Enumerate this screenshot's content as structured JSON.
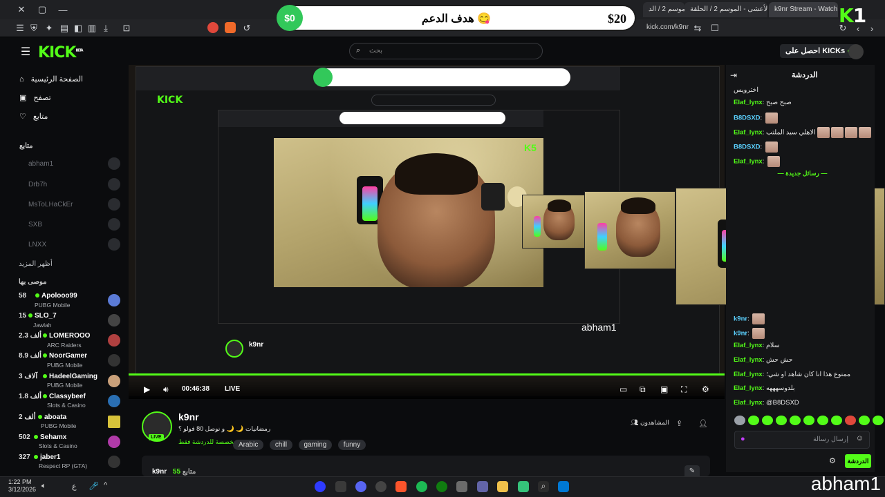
{
  "browser": {
    "tabs": [
      {
        "label": "الموسم 2 / الد"
      },
      {
        "label": "شاهد شارع الأعشى - الموسم 2 / الحلقة"
      },
      {
        "label": "k9nr Stream - Watch Live on Kick"
      }
    ],
    "url": "kick.com/k9nr"
  },
  "goal": {
    "start": "$0",
    "title": "هدف الدعم",
    "amount": "$20"
  },
  "logo_num": "1",
  "header": {
    "brand": "KICK",
    "beta": "BETA",
    "search_placeholder": "بحث",
    "get_kicks": "احصل على KICKs"
  },
  "sidebar": {
    "nav": [
      {
        "label": "الصفحة الرئيسية",
        "icon": "home-icon"
      },
      {
        "label": "تصفح",
        "icon": "browse-icon"
      },
      {
        "label": "متابع",
        "icon": "heart-icon"
      }
    ],
    "following_title": "متابع",
    "following": [
      {
        "name": "abham1"
      },
      {
        "name": "Drb7h"
      },
      {
        "name": "MsToLHaCkEr"
      },
      {
        "name": "SXB"
      },
      {
        "name": "LNXX"
      }
    ],
    "show_more": "أظهر المزيد",
    "recommended_title": "موصى بها",
    "recommended": [
      {
        "count": "58",
        "name": "Apolooo99",
        "category": "PUBG Mobile",
        "color": "#5b7bd6"
      },
      {
        "count": "15",
        "name": "SLO_7",
        "category": "Jawlah",
        "color": "#444"
      },
      {
        "count": "2.3 ألف",
        "name": "LOMEROOO",
        "category": "ARC Raiders",
        "color": "#b04040"
      },
      {
        "count": "8.9 ألف",
        "name": "NoorGamer",
        "category": "PUBG Mobile",
        "color": "#333"
      },
      {
        "count": "3 آلاف",
        "name": "HadeelGaming",
        "category": "PUBG Mobile",
        "color": "#c9a07a"
      },
      {
        "count": "1.8 ألف",
        "name": "Classybeef",
        "category": "Slots & Casino",
        "color": "#2a6fb3"
      },
      {
        "count": "2 ألف",
        "name": "aboata",
        "category": "PUBG Mobile",
        "color": "#d7c23a"
      },
      {
        "count": "502",
        "name": "Sehamx",
        "category": "Slots & Casino",
        "color": "#b03aa8"
      },
      {
        "count": "327",
        "name": "jaber1",
        "category": "Respect RP (GTA)",
        "color": "#333"
      }
    ]
  },
  "player": {
    "time": "00:46:38",
    "live": "LIVE",
    "overlay_name": "abham1"
  },
  "stream": {
    "name": "k9nr",
    "live": "LIVE",
    "title": "رمضانيات 🌙 🌙 و نوصل 80 فولو ؟",
    "subtitle": "مخصصة للدردشة فقط",
    "tags": [
      "Arabic",
      "chill",
      "gaming",
      "funny"
    ],
    "viewers_label": "المشاهدون",
    "followers": "55",
    "followers_label": "متابع",
    "bottom_name": "k9nr"
  },
  "chat": {
    "title": "الدردشة",
    "messages": [
      {
        "user": "",
        "text": "اخترويس"
      },
      {
        "user": "Elaf_lynx",
        "text": "صبح صبح"
      },
      {
        "user": "B8DSXD",
        "text": "",
        "emotes": 1
      },
      {
        "user": "Elaf_lynx",
        "text": "الاهلي سيد الملتب",
        "emotes": 4
      },
      {
        "user": "B8DSXD",
        "text": "",
        "emotes": 1
      },
      {
        "user": "Elaf_lynx",
        "text": "",
        "emotes": 1
      }
    ],
    "new_messages": "رسائل جديدة",
    "messages2": [
      {
        "user": "k9nr",
        "text": "",
        "emotes": 1
      },
      {
        "user": "k9nr",
        "text": "",
        "emotes": 1
      },
      {
        "user": "Elaf_lynx",
        "text": "سلام"
      },
      {
        "user": "Elaf_lynx",
        "text": "حش حش"
      },
      {
        "user": "Elaf_lynx",
        "text": "ممنوع هذا انا كان شاهد او شي؛"
      },
      {
        "user": "Elaf_lynx",
        "text": "بلدوسهههه"
      },
      {
        "user": "Elaf_lynx",
        "text": "@B8DSXD"
      }
    ],
    "input_placeholder": "إرسال رسالة",
    "send_button": "الدردشة"
  },
  "taskbar": {
    "time": "1:22 PM",
    "date": "3/12/2026",
    "lang": "ع"
  },
  "watermark": "abham1"
}
